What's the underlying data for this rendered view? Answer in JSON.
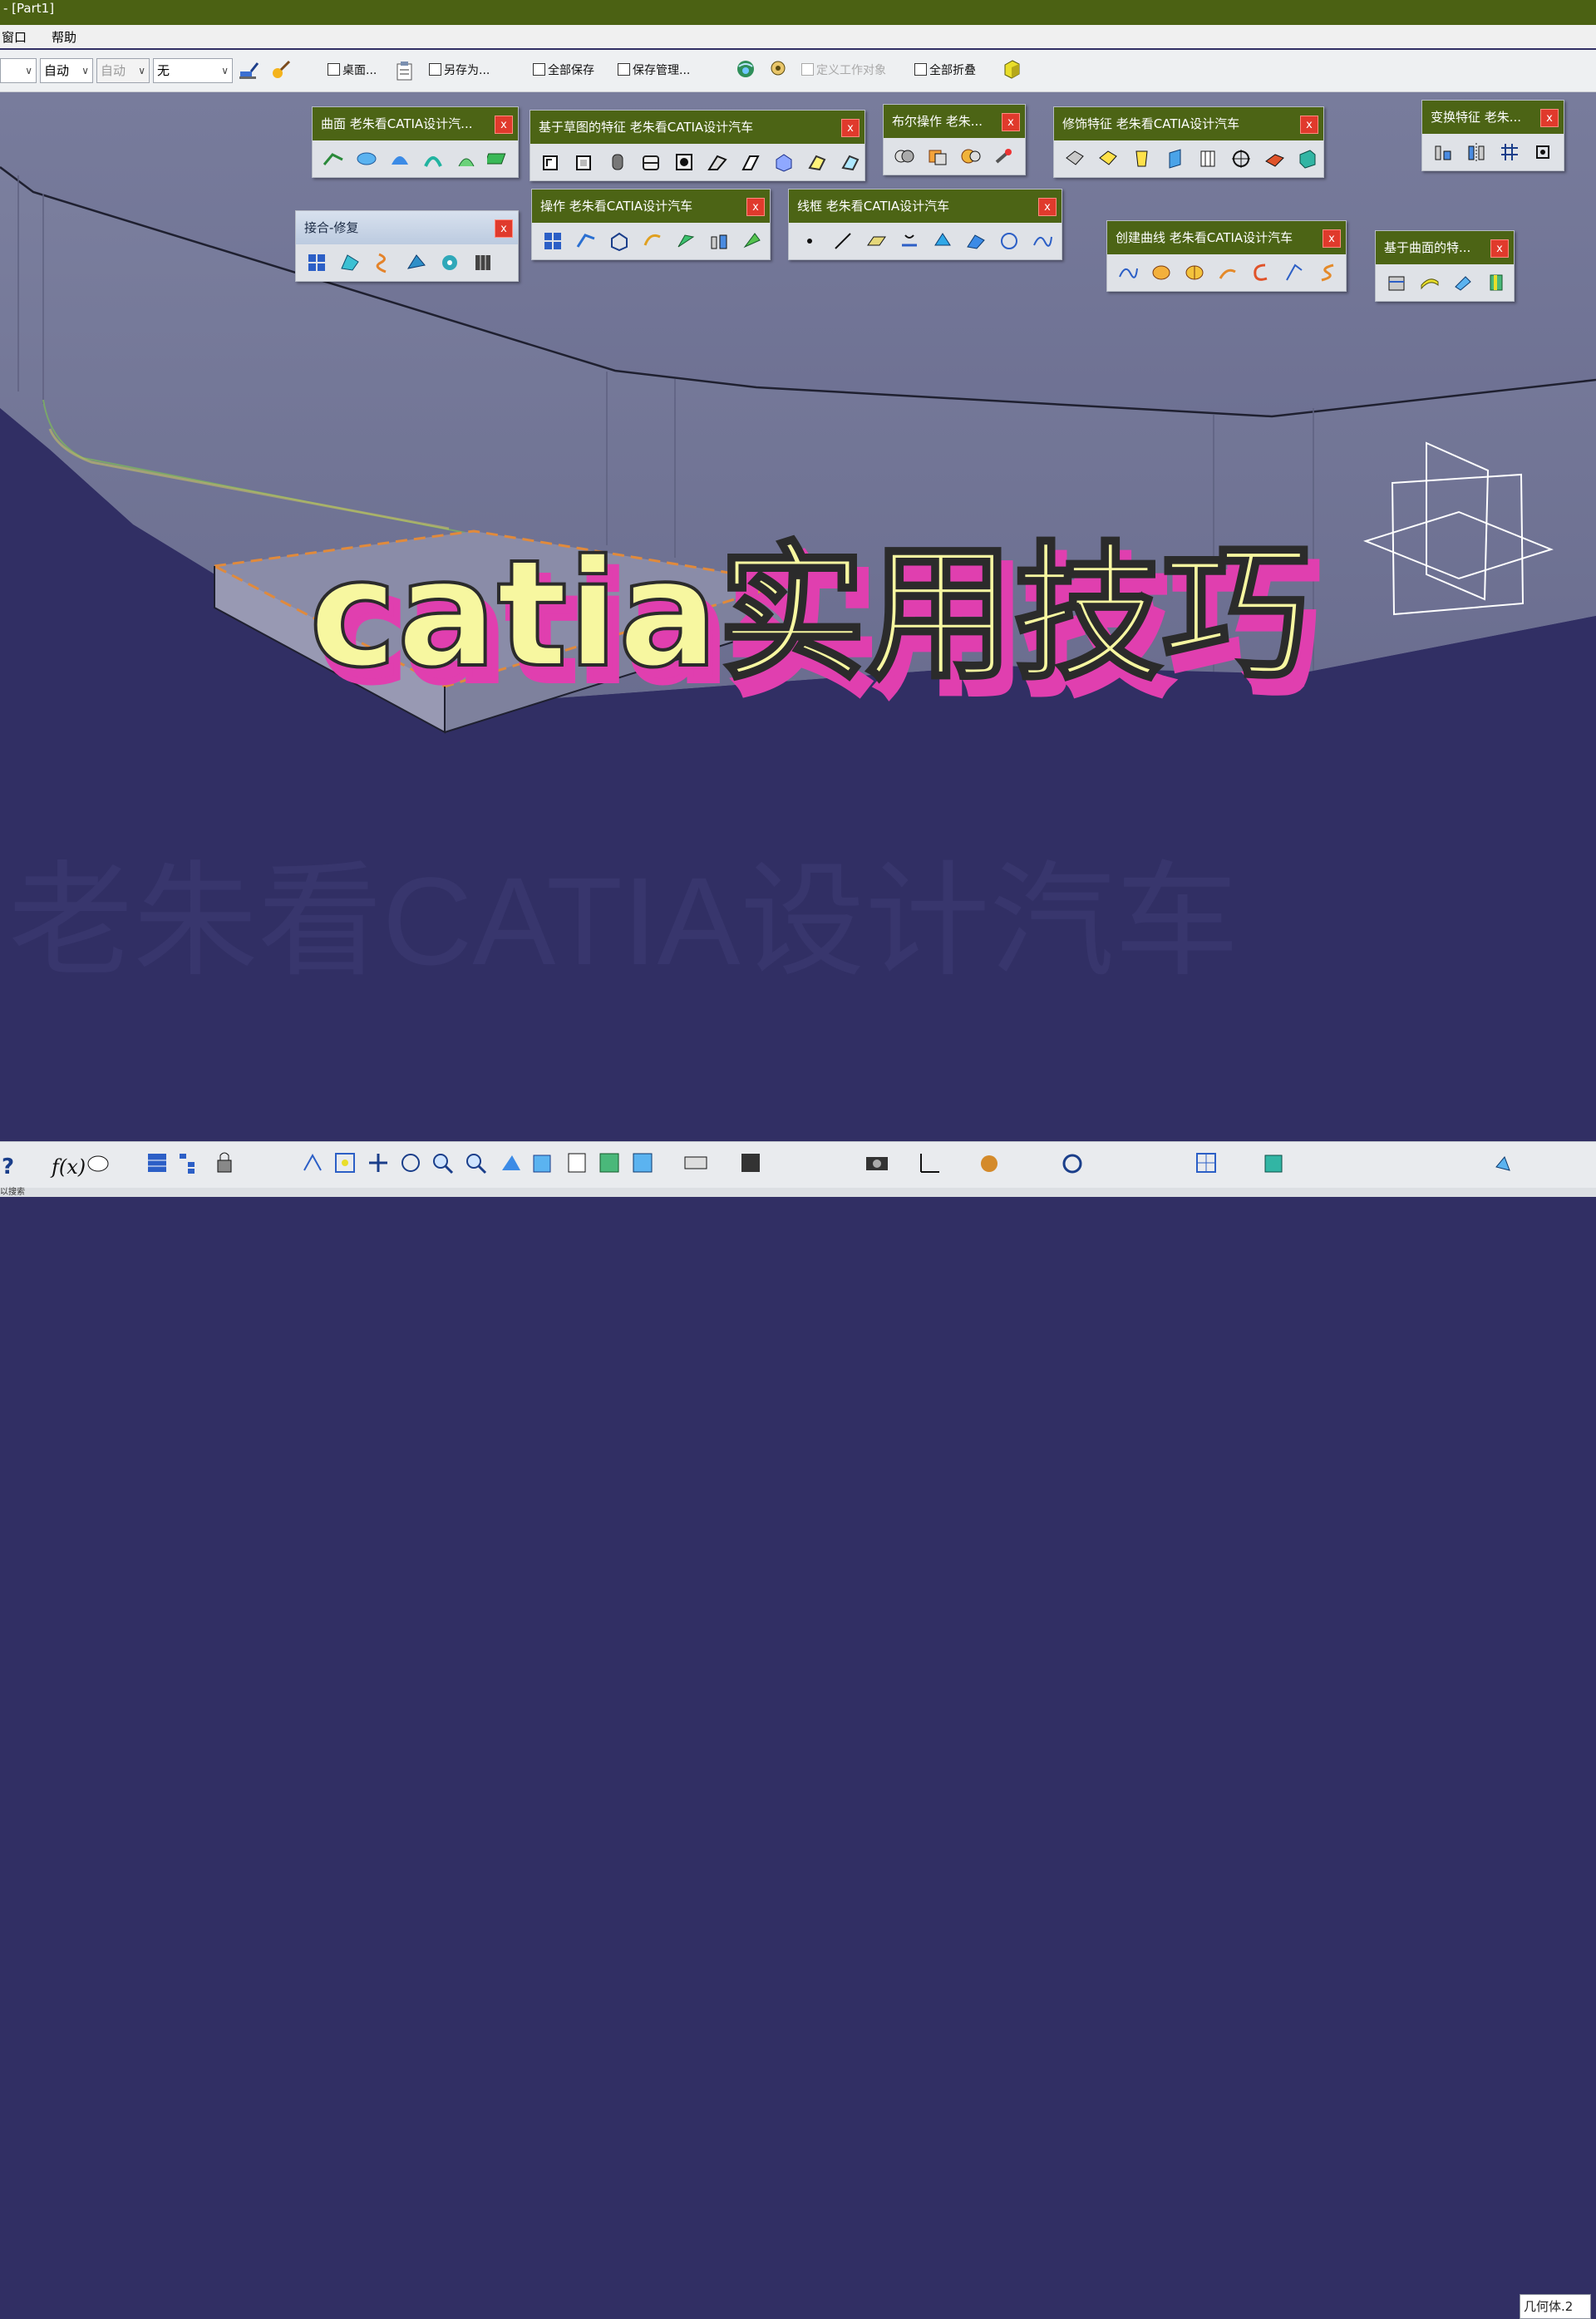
{
  "window": {
    "title": "- [Part1]"
  },
  "menu": {
    "items": [
      "窗口",
      "帮助"
    ]
  },
  "toolbar": {
    "combos": [
      {
        "value": "",
        "disabled": false
      },
      {
        "value": "自动",
        "disabled": false
      },
      {
        "value": "自动",
        "disabled": true
      },
      {
        "value": "无",
        "disabled": false
      }
    ],
    "checkboxes": [
      {
        "label": "桌面...",
        "disabled": false
      },
      {
        "label": "另存为...",
        "disabled": false
      },
      {
        "label": "全部保存",
        "disabled": false
      },
      {
        "label": "保存管理...",
        "disabled": false
      },
      {
        "label": "定义工作对象",
        "disabled": true
      },
      {
        "label": "全部折叠",
        "disabled": false
      }
    ]
  },
  "palettes": [
    {
      "title": "曲面 老朱看CATIA设计汽...",
      "close": "x"
    },
    {
      "title": "基于草图的特征 老朱看CATIA设计汽车",
      "close": "x"
    },
    {
      "title": "布尔操作 老朱...",
      "close": "x"
    },
    {
      "title": "修饰特征 老朱看CATIA设计汽车",
      "close": "x"
    },
    {
      "title": "变换特征 老朱...",
      "close": "x"
    },
    {
      "title": "接合-修复",
      "close": "x"
    },
    {
      "title": "操作 老朱看CATIA设计汽车",
      "close": "x"
    },
    {
      "title": "线框 老朱看CATIA设计汽车",
      "close": "x"
    },
    {
      "title": "创建曲线 老朱看CATIA设计汽车",
      "close": "x"
    },
    {
      "title": "基于曲面的特...",
      "close": "x"
    }
  ],
  "overlay": {
    "headline": "catia实用技巧",
    "watermark": "老朱看CATIA设计汽车"
  },
  "statusbar": {
    "geometry_combo": "几何体.2",
    "hint": "以搜索"
  },
  "colors": {
    "title_bar": "#4b6113",
    "viewport_bg": "#312f64",
    "headline_fill": "#f7f7a0",
    "headline_shadow": "#e03faf",
    "palette_close": "#e03a2c"
  }
}
